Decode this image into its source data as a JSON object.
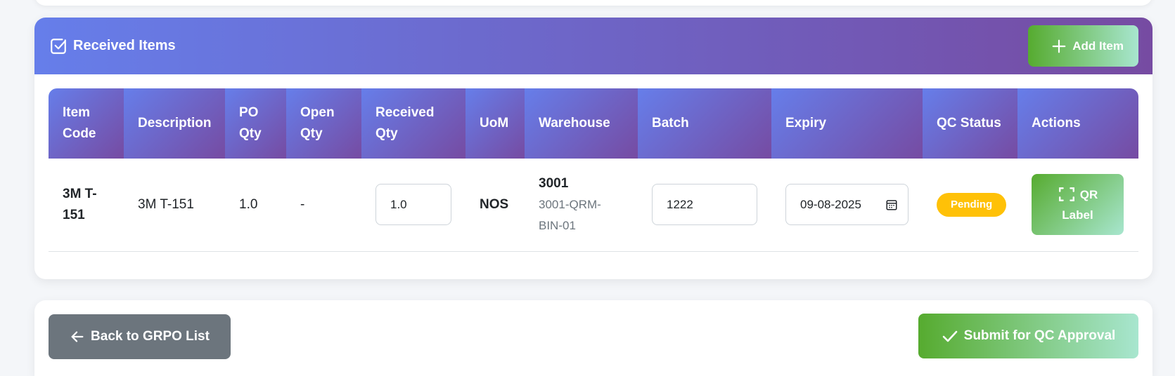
{
  "card": {
    "title": "Received Items",
    "add_button_label": "Add Item"
  },
  "table": {
    "headers": {
      "item_code": "Item Code",
      "description": "Description",
      "po_qty": "PO Qty",
      "open_qty": "Open Qty",
      "received_qty": "Received Qty",
      "uom": "UoM",
      "warehouse": "Warehouse",
      "batch": "Batch",
      "expiry": "Expiry",
      "qc_status": "QC Status",
      "actions": "Actions"
    },
    "rows": [
      {
        "item_code": "3M T-151",
        "description": "3M T-151",
        "po_qty": "1.0",
        "open_qty": "-",
        "received_qty": "1.0",
        "uom": "NOS",
        "warehouse_code": "3001",
        "warehouse_bin": "3001-QRM-BIN-01",
        "batch": "1222",
        "expiry": "09-08-2025",
        "qc_status": "Pending",
        "qr_label_line1": "QR",
        "qr_label_line2": "Label"
      }
    ]
  },
  "footer": {
    "back_label": "Back to GRPO List",
    "submit_label": "Submit for QC Approval"
  },
  "colors": {
    "header_gradient_start": "#667eea",
    "header_gradient_end": "#764ba2",
    "success_gradient_start": "#56ab2f",
    "success_gradient_end": "#a8e6cf",
    "pending_badge": "#ffc107",
    "back_button": "#6c757d"
  },
  "icons": {
    "title_icon": "check-square-icon",
    "add_icon": "plus-icon",
    "calendar_icon": "calendar-icon",
    "qr_icon": "qr-scan-icon",
    "back_icon": "arrow-left-icon",
    "submit_icon": "check-icon"
  }
}
